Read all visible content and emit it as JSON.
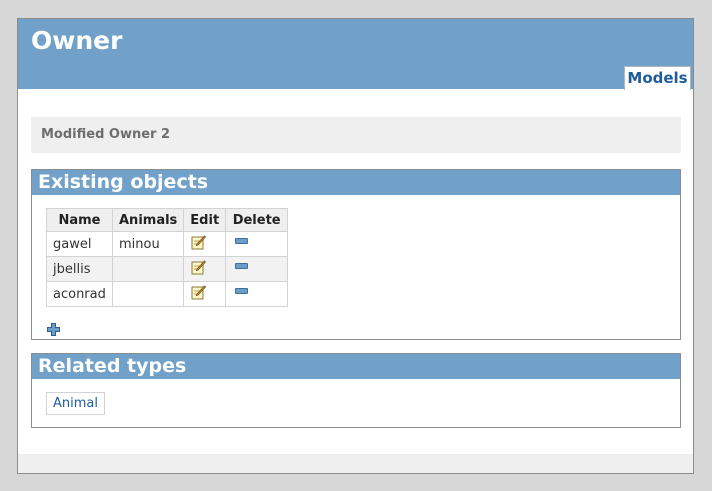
{
  "header": {
    "title": "Owner",
    "tab_label": "Models"
  },
  "message": "Modified Owner 2",
  "existing": {
    "heading": "Existing objects",
    "columns": [
      "Name",
      "Animals",
      "Edit",
      "Delete"
    ],
    "rows": [
      {
        "name": "gawel",
        "animals": "minou"
      },
      {
        "name": "jbellis",
        "animals": ""
      },
      {
        "name": "aconrad",
        "animals": ""
      }
    ]
  },
  "related": {
    "heading": "Related types",
    "link": "Animal"
  },
  "colors": {
    "header_bg": "#71a1c8",
    "link": "#1e5d9b",
    "panel_bg": "#efefef"
  },
  "icons": {
    "edit": "edit-pencil-icon",
    "delete": "delete-minus-icon",
    "add": "add-plus-icon"
  }
}
